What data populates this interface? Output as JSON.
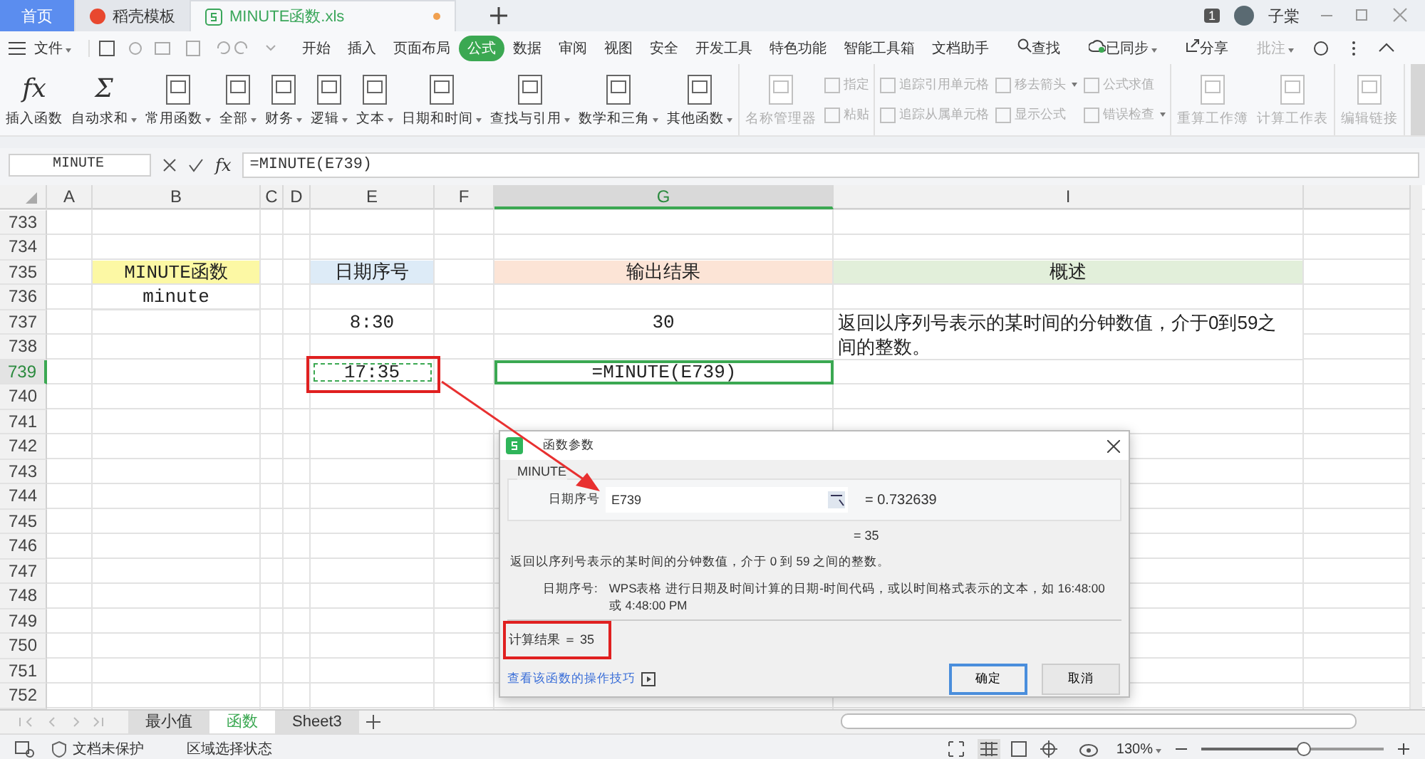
{
  "title_tabs": [
    {
      "label": "首页",
      "kind": "home",
      "selected": false,
      "modified": false
    },
    {
      "label": "稻壳模板",
      "kind": "template",
      "selected": false,
      "modified": false
    },
    {
      "label": "MINUTE函数.xls",
      "kind": "sheet",
      "selected": true,
      "modified": true
    }
  ],
  "title_bar": {
    "badge": "1",
    "user": "子棠"
  },
  "menu": {
    "file": "文件",
    "tabs": [
      {
        "label": "开始",
        "selected": false
      },
      {
        "label": "插入",
        "selected": false
      },
      {
        "label": "页面布局",
        "selected": false
      },
      {
        "label": "公式",
        "selected": true
      },
      {
        "label": "数据",
        "selected": false
      },
      {
        "label": "审阅",
        "selected": false
      },
      {
        "label": "视图",
        "selected": false
      },
      {
        "label": "安全",
        "selected": false
      },
      {
        "label": "开发工具",
        "selected": false
      },
      {
        "label": "特色功能",
        "selected": false
      },
      {
        "label": "智能工具箱",
        "selected": false
      },
      {
        "label": "文档助手",
        "selected": false
      }
    ],
    "search": "查找",
    "sync": "已同步",
    "share": "分享",
    "comment": "批注"
  },
  "ribbon": [
    [
      {
        "kind": "large",
        "label": "插入函数",
        "glyph": "fx",
        "menu": false,
        "disabled": false
      },
      {
        "kind": "large",
        "label": "自动求和",
        "glyph": "Σ",
        "menu": true,
        "disabled": false
      },
      {
        "kind": "large",
        "label": "常用函数",
        "menu": true,
        "disabled": false
      },
      {
        "kind": "large",
        "label": "全部",
        "menu": true,
        "disabled": false
      },
      {
        "kind": "large",
        "label": "财务",
        "menu": true,
        "disabled": false
      },
      {
        "kind": "large",
        "label": "逻辑",
        "menu": true,
        "disabled": false
      },
      {
        "kind": "large",
        "label": "文本",
        "menu": true,
        "disabled": false
      },
      {
        "kind": "large",
        "label": "日期和时间",
        "menu": true,
        "disabled": false
      },
      {
        "kind": "large",
        "label": "查找与引用",
        "menu": true,
        "disabled": false
      },
      {
        "kind": "large",
        "label": "数学和三角",
        "menu": true,
        "disabled": false
      },
      {
        "kind": "large",
        "label": "其他函数",
        "menu": true,
        "disabled": false
      }
    ],
    [
      {
        "kind": "large",
        "label": "名称管理器",
        "menu": false,
        "disabled": true
      },
      {
        "kind": "stack",
        "items": [
          {
            "label": "指定",
            "menu": false,
            "disabled": true
          },
          {
            "label": "粘贴",
            "menu": false,
            "disabled": true
          }
        ]
      }
    ],
    [
      {
        "kind": "stack",
        "items": [
          {
            "label": "追踪引用单元格",
            "menu": false,
            "disabled": true
          },
          {
            "label": "追踪从属单元格",
            "menu": false,
            "disabled": true
          }
        ]
      },
      {
        "kind": "stack",
        "items": [
          {
            "label": "移去箭头",
            "menu": true,
            "disabled": true
          },
          {
            "label": "显示公式",
            "menu": false,
            "disabled": true
          }
        ]
      },
      {
        "kind": "stack",
        "items": [
          {
            "label": "公式求值",
            "menu": false,
            "disabled": true
          },
          {
            "label": "错误检查",
            "menu": true,
            "disabled": true
          }
        ]
      }
    ],
    [
      {
        "kind": "large",
        "label": "重算工作簿",
        "menu": false,
        "disabled": true
      },
      {
        "kind": "large",
        "label": "计算工作表",
        "menu": false,
        "disabled": true
      }
    ],
    [
      {
        "kind": "large",
        "label": "编辑链接",
        "menu": false,
        "disabled": true
      }
    ]
  ],
  "formula_bar": {
    "name_box": "MINUTE",
    "fx": "fx",
    "formula": "=MINUTE(E739)"
  },
  "columns": [
    {
      "label": "A",
      "selected": false
    },
    {
      "label": "B",
      "selected": false
    },
    {
      "label": "C",
      "selected": false
    },
    {
      "label": "D",
      "selected": false
    },
    {
      "label": "E",
      "selected": false
    },
    {
      "label": "F",
      "selected": false
    },
    {
      "label": "G",
      "selected": true
    },
    {
      "label": "I",
      "selected": false
    }
  ],
  "rows": [
    {
      "number": "733",
      "selected": false
    },
    {
      "number": "734",
      "selected": false
    },
    {
      "number": "735",
      "selected": false,
      "cells": {
        "b": {
          "text": "MINUTE函数",
          "color": "#fcf8a4",
          "selected": false,
          "marked": false,
          "wrap": false
        },
        "e": {
          "text": "日期序号",
          "color": "#ddebf7",
          "selected": false,
          "marked": false,
          "wrap": false
        },
        "g": {
          "text": "输出结果",
          "color": "#fce4d6",
          "selected": false,
          "marked": false,
          "wrap": false
        },
        "i": {
          "text": "概述",
          "color": "#e2efda",
          "selected": false,
          "marked": false,
          "wrap": false
        }
      }
    },
    {
      "number": "736",
      "selected": false,
      "cells": {
        "b": {
          "text": "minute",
          "selected": false,
          "marked": false,
          "wrap": false
        }
      }
    },
    {
      "number": "737",
      "selected": false,
      "cells": {
        "e": {
          "text": "8:30",
          "selected": false,
          "marked": false,
          "wrap": false
        },
        "g": {
          "text": "30",
          "selected": false,
          "marked": false,
          "wrap": false
        },
        "i": {
          "text": "返回以序列号表示的某时间的分钟数值，介于0到59之间的整数。",
          "selected": false,
          "marked": false,
          "wrap": true
        }
      }
    },
    {
      "number": "738",
      "selected": false
    },
    {
      "number": "739",
      "selected": true,
      "cells": {
        "e": {
          "text": "17:35",
          "selected": false,
          "marked": true,
          "wrap": false
        },
        "g": {
          "text": "=MINUTE(E739)",
          "selected": true,
          "marked": false,
          "wrap": false
        }
      }
    },
    {
      "number": "740",
      "selected": false
    },
    {
      "number": "741",
      "selected": false
    },
    {
      "number": "742",
      "selected": false
    },
    {
      "number": "743",
      "selected": false
    },
    {
      "number": "744",
      "selected": false
    },
    {
      "number": "745",
      "selected": false
    },
    {
      "number": "746",
      "selected": false
    },
    {
      "number": "747",
      "selected": false
    },
    {
      "number": "748",
      "selected": false
    },
    {
      "number": "749",
      "selected": false
    },
    {
      "number": "750",
      "selected": false
    },
    {
      "number": "751",
      "selected": false
    },
    {
      "number": "752",
      "selected": false
    }
  ],
  "dialog": {
    "title": "函数参数",
    "group": "MINUTE",
    "arg_label": "日期序号",
    "arg_value": "E739",
    "arg_result": "= 0.732639",
    "result": "= 35",
    "description": "返回以序列号表示的某时间的分钟数值，介于 0 到 59 之间的整数。",
    "param_name": "日期序号:",
    "param_help": "WPS表格 进行日期及时间计算的日期-时间代码，或以时间格式表示的文本，如 16:48:00 或 4:48:00 PM",
    "calc_result": "计算结果 ＝ 35",
    "link": "查看该函数的操作技巧",
    "ok": "确定",
    "cancel": "取消"
  },
  "sheet_tabs": [
    {
      "label": "最小值",
      "selected": false
    },
    {
      "label": "函数",
      "selected": true
    },
    {
      "label": "Sheet3",
      "selected": false
    }
  ],
  "status_bar": {
    "protect": "文档未保护",
    "selection": "区域选择状态",
    "zoom": "130%",
    "zoom_level": {
      "level": 0.56
    }
  }
}
